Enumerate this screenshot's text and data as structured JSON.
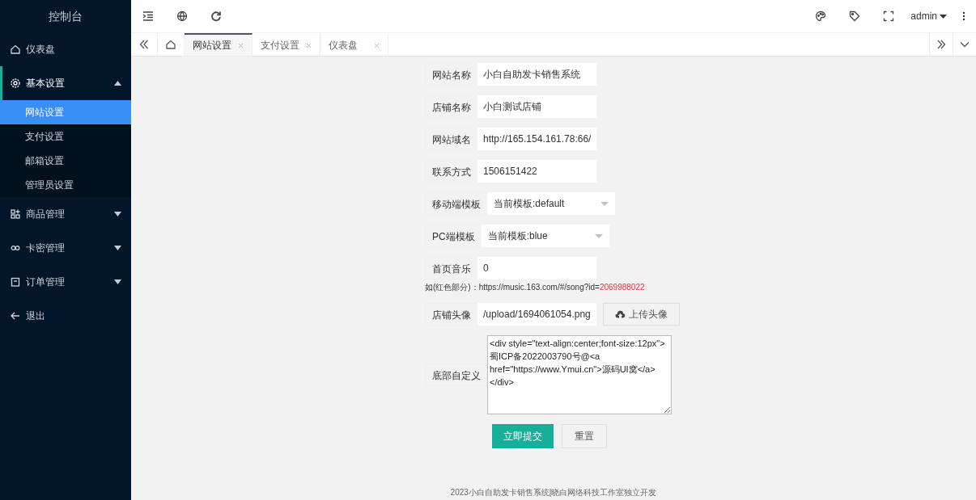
{
  "sidebar": {
    "title": "控制台",
    "items": [
      {
        "label": "仪表盘"
      },
      {
        "label": "基本设置",
        "expanded": true,
        "children": [
          {
            "label": "网站设置",
            "selected": true
          },
          {
            "label": "支付设置",
            "selected": false
          },
          {
            "label": "邮箱设置",
            "selected": false
          },
          {
            "label": "管理员设置",
            "selected": false
          }
        ]
      },
      {
        "label": "商品管理",
        "expanded": false
      },
      {
        "label": "卡密管理",
        "expanded": false
      },
      {
        "label": "订单管理",
        "expanded": false
      },
      {
        "label": "退出"
      }
    ]
  },
  "header": {
    "user": "admin"
  },
  "tabs": [
    {
      "label": "网站设置",
      "selected": true
    },
    {
      "label": "支付设置",
      "selected": false
    },
    {
      "label": "仪表盘",
      "selected": false
    }
  ],
  "form": {
    "fields": [
      {
        "kind": "input",
        "label": "网站名称",
        "value": "小白自助发卡销售系统"
      },
      {
        "kind": "input",
        "label": "店铺名称",
        "value": "小白测试店铺"
      },
      {
        "kind": "input",
        "label": "网站域名",
        "value": "http://165.154.161.78:66/"
      },
      {
        "kind": "input",
        "label": "联系方式",
        "value": "1506151422"
      },
      {
        "kind": "select",
        "label": "移动端模板",
        "value": "当前模板:default"
      },
      {
        "kind": "select",
        "label": "PC端模板",
        "value": "当前模板:blue"
      },
      {
        "kind": "input",
        "label": "首页音乐",
        "value": "0",
        "hint": {
          "text": "如(红色部分)：https://music.163.com/#/song?id=",
          "highlight": "2069988022"
        }
      },
      {
        "kind": "upload",
        "label": "店铺头像",
        "value": "/upload/1694061054.png",
        "button": "上传头像"
      },
      {
        "kind": "textarea",
        "label": "底部自定义",
        "value": "<div style=\"text-align:center;font-size:12px\">蜀ICP备2022003790号@<a href=\"https://www.Ymui.cn\">源码UI窝</a></div>"
      }
    ],
    "submit": "立即提交",
    "reset": "重置"
  },
  "footer": "2023小白自助发卡销售系统|晓白网络科技工作室独立开发"
}
